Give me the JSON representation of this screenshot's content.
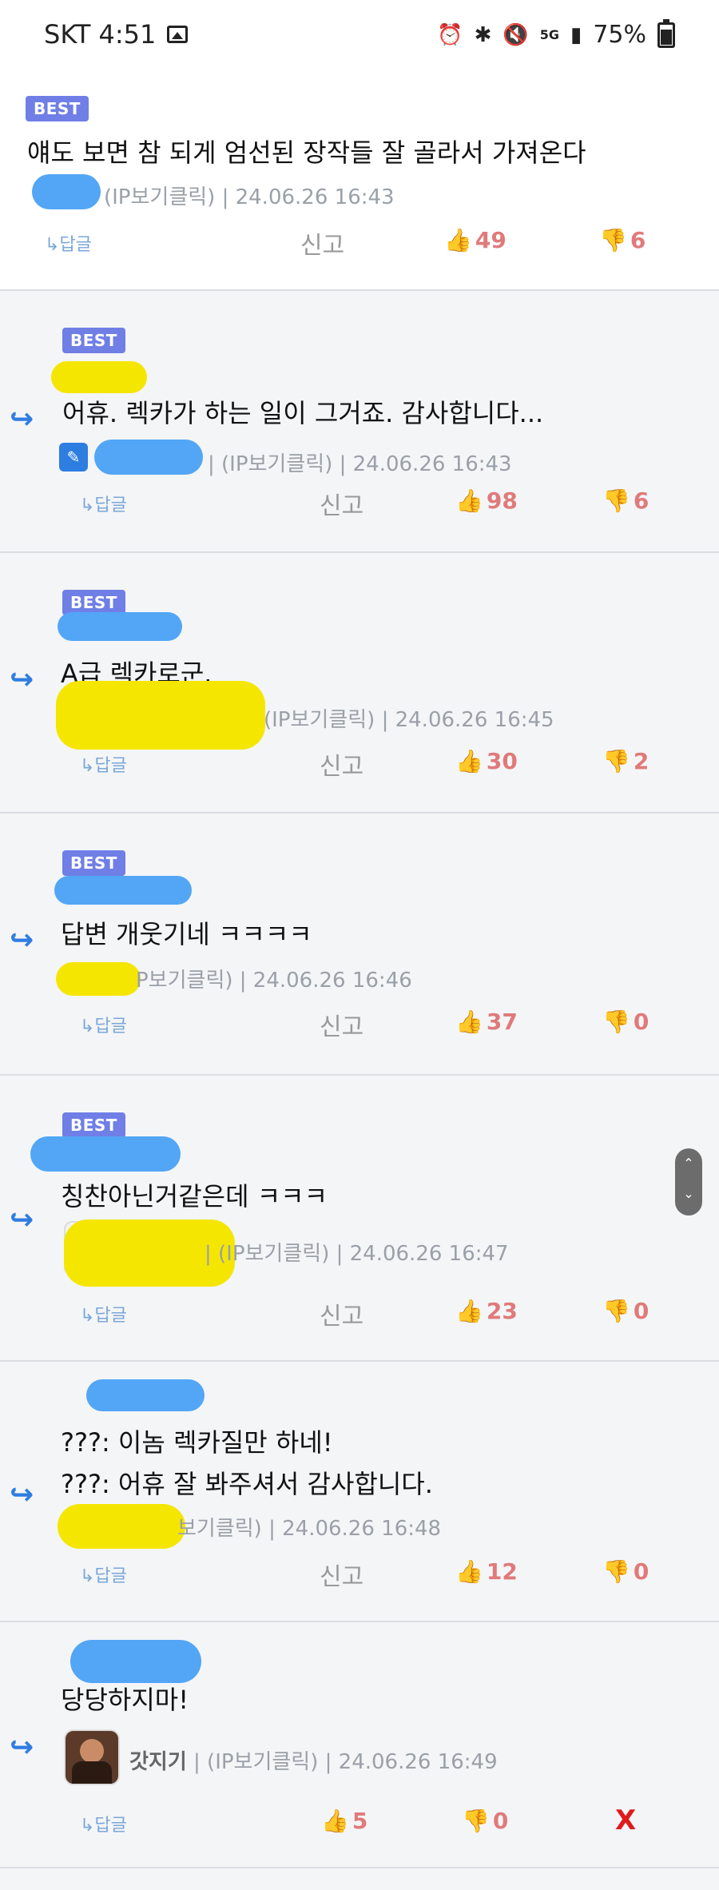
{
  "status_bar": {
    "carrier_time": "SKT 4:51",
    "battery": "75%",
    "network": "5G"
  },
  "actions": {
    "reply": "↳답글",
    "report": "신고"
  },
  "comments": [
    {
      "best": "BEST",
      "text": "얘도 보면 참 되게 엄선된 장작들 잘 골라서 가져온다",
      "meta": "(IP보기클릭) | 24.06.26 16:43",
      "likes": "49",
      "dislikes": "6"
    },
    {
      "best": "BEST",
      "text": "어휴. 렉카가 하는 일이 그거죠. 감사합니다...",
      "meta": "| (IP보기클릭) | 24.06.26 16:43",
      "likes": "98",
      "dislikes": "6"
    },
    {
      "best": "BEST",
      "text": "A급 렉카로군.",
      "meta": "(IP보기클릭) | 24.06.26 16:45",
      "likes": "30",
      "dislikes": "2"
    },
    {
      "best": "BEST",
      "text": "답변 개웃기네 ㅋㅋㅋㅋ",
      "meta": "P보기클릭) | 24.06.26 16:46",
      "likes": "37",
      "dislikes": "0"
    },
    {
      "best": "BEST",
      "text": "칭찬아닌거같은데 ㅋㅋㅋ",
      "meta": "| (IP보기클릭) | 24.06.26 16:47",
      "likes": "23",
      "dislikes": "0"
    },
    {
      "text_lines": [
        "???: 이놈 렉카질만 하네!",
        "???: 어휴 잘 봐주셔서 감사합니다."
      ],
      "meta": "보기클릭) | 24.06.26 16:48",
      "likes": "12",
      "dislikes": "0"
    },
    {
      "text": "당당하지마!",
      "author": "갓지기",
      "meta": "| (IP보기클릭) | 24.06.26 16:49",
      "likes": "5",
      "dislikes": "0",
      "close": "X"
    }
  ]
}
